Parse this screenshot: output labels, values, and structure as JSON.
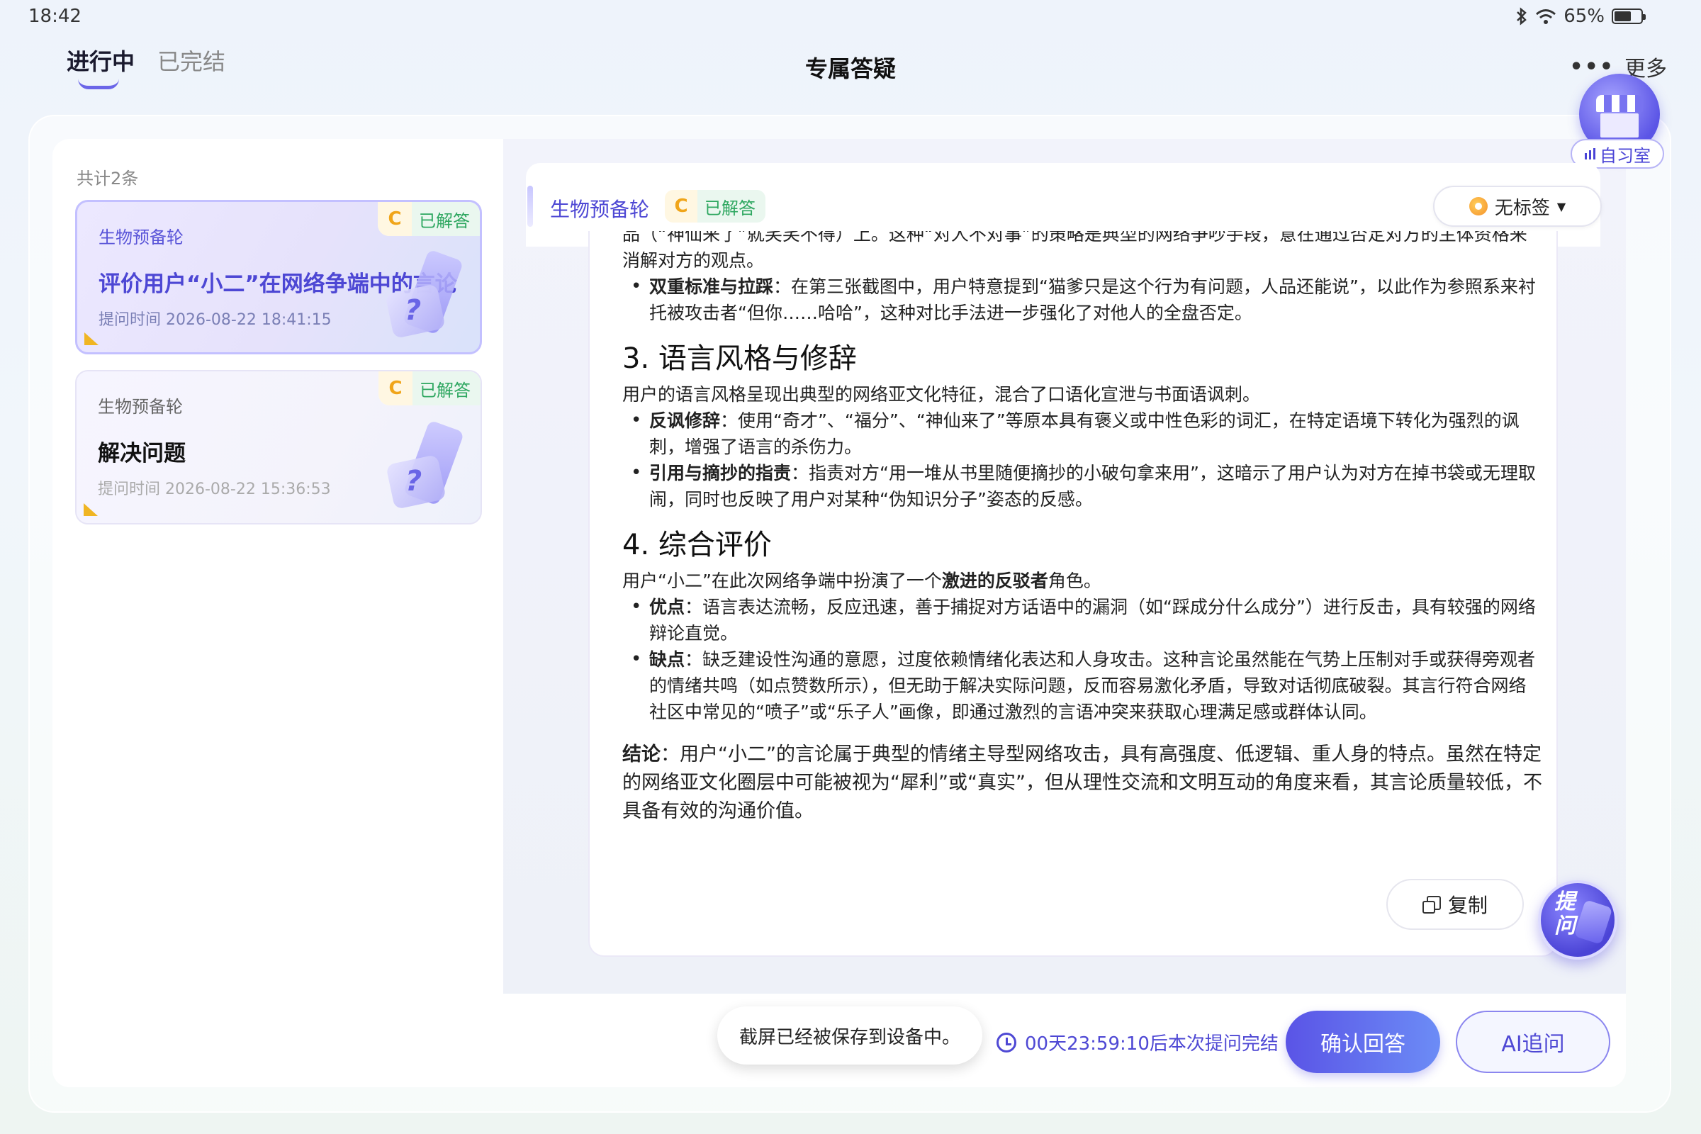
{
  "status_bar": {
    "time": "18:42",
    "battery": "65%",
    "battery_level": 0.65,
    "icons": [
      "bluetooth-icon",
      "wifi-icon",
      "battery-icon"
    ]
  },
  "top_nav": {
    "tabs": [
      {
        "label": "进行中",
        "active": true
      },
      {
        "label": "已完结",
        "active": false
      }
    ],
    "title": "专属答疑",
    "more_label": "更多"
  },
  "study_room": {
    "label": "自习室"
  },
  "list": {
    "count_label": "共计2条",
    "items": [
      {
        "subject": "生物预备轮",
        "badge_letter": "C",
        "status": "已解答",
        "title": "评价用户“小二”在网络争端中的言论",
        "time": "提问时间 2026-08-22 18:41:15",
        "selected": true
      },
      {
        "subject": "生物预备轮",
        "badge_letter": "C",
        "status": "已解答",
        "title": "解决问题",
        "time": "提问时间 2026-08-22 15:36:53",
        "selected": false
      }
    ]
  },
  "answer": {
    "subject": "生物预备轮",
    "badge_letter": "C",
    "status": "已解答",
    "tag_label": "无标签",
    "partial_top": "品（“神仙来了”就笑笑不得）上。这种“对人不对事”的策略是典型的网络争吵手段，意在通过否定对方的主体资格来消解对方的观点。",
    "bullet_double": {
      "bold": "双重标准与拉踩",
      "text": "：在第三张截图中，用户特意提到“猫爹只是这个行为有问题，人品还能说”，以此作为参照系来衬托被攻击者“但你……哈哈”，这种对比手法进一步强化了对他人的全盘否定。"
    },
    "section3": {
      "heading": "3. 语言风格与修辞",
      "intro": "用户的语言风格呈现出典型的网络亚文化特征，混合了口语化宣泄与书面语讽刺。",
      "bullets": [
        {
          "bold": "反讽修辞",
          "text": "：使用“奇才”、“福分”、“神仙来了”等原本具有褒义或中性色彩的词汇，在特定语境下转化为强烈的讽刺，增强了语言的杀伤力。"
        },
        {
          "bold": "引用与摘抄的指责",
          "text": "：指责对方“用一堆从书里随便摘抄的小破句拿来用”，这暗示了用户认为对方在掉书袋或无理取闹，同时也反映了用户对某种“伪知识分子”姿态的反感。"
        }
      ]
    },
    "section4": {
      "heading": "4. 综合评价",
      "intro_pre": "用户“小二”在此次网络争端中扮演了一个",
      "intro_bold": "激进的反驳者",
      "intro_post": "角色。",
      "bullets": [
        {
          "bold": "优点",
          "text": "：语言表达流畅，反应迅速，善于捕捉对方话语中的漏洞（如“踩成分什么成分”）进行反击，具有较强的网络辩论直觉。"
        },
        {
          "bold": "缺点",
          "text": "：缺乏建设性沟通的意愿，过度依赖情绪化表达和人身攻击。这种言论虽然能在气势上压制对手或获得旁观者的情绪共鸣（如点赞数所示），但无助于解决实际问题，反而容易激化矛盾，导致对话彻底破裂。其言行符合网络社区中常见的“喷子”或“乐子人”画像，即通过激烈的言语冲突来获取心理满足感或群体认同。"
        }
      ]
    },
    "conclusion": {
      "bold": "结论",
      "text": "：用户“小二”的言论属于典型的情绪主导型网络攻击，具有高强度、低逻辑、重人身的特点。虽然在特定的网络亚文化圈层中可能被视为“犀利”或“真实”，但从理性交流和文明互动的角度来看，其言论质量较低，不具备有效的沟通价值。"
    },
    "copy_label": "复制",
    "ask_label": "提问"
  },
  "bottom": {
    "toast": "截屏已经被保存到设备中。",
    "countdown": "00天23:59:10后本次提问完结",
    "confirm_label": "确认回答",
    "ai_label": "AI追问"
  },
  "colors": {
    "accent": "#5a54e6",
    "answered_green": "#2ea760",
    "badge_orange": "#f0a51a"
  }
}
